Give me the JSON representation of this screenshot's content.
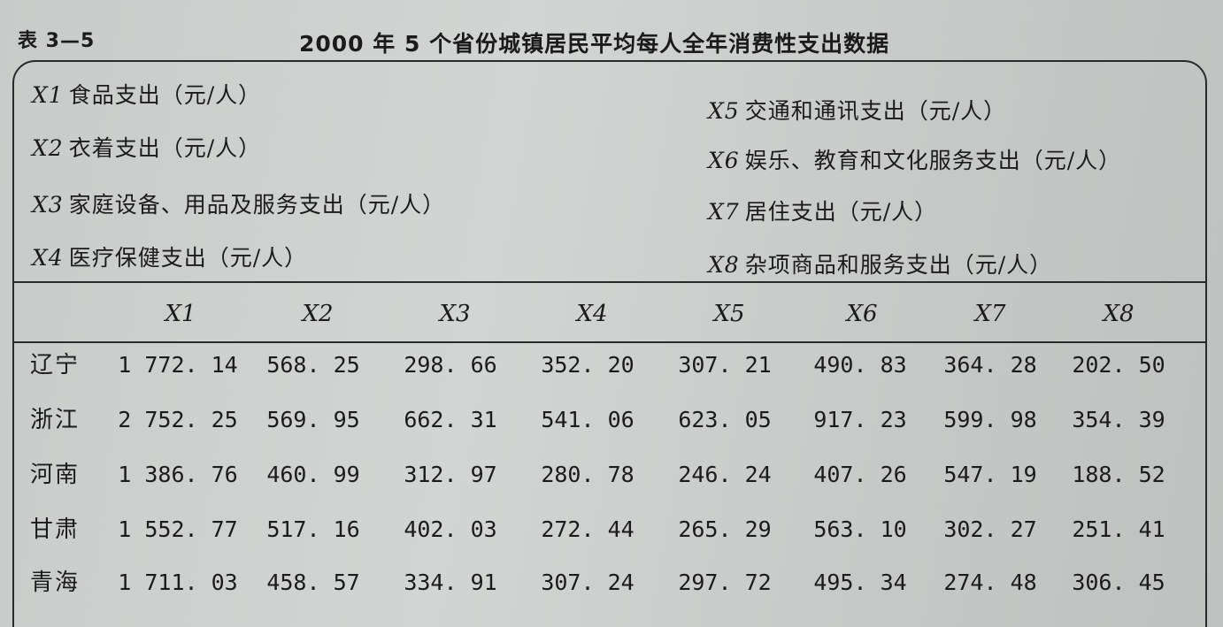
{
  "table_number": "表 3—5",
  "title": "2000 年 5 个省份城镇居民平均每人全年消费性支出数据",
  "legend": [
    {
      "code": "X1",
      "desc": "食品支出（元/人）"
    },
    {
      "code": "X2",
      "desc": "衣着支出（元/人）"
    },
    {
      "code": "X3",
      "desc": "家庭设备、用品及服务支出（元/人）"
    },
    {
      "code": "X4",
      "desc": "医疗保健支出（元/人）"
    },
    {
      "code": "X5",
      "desc": "交通和通讯支出（元/人）"
    },
    {
      "code": "X6",
      "desc": "娱乐、教育和文化服务支出（元/人）"
    },
    {
      "code": "X7",
      "desc": "居住支出（元/人）"
    },
    {
      "code": "X8",
      "desc": "杂项商品和服务支出（元/人）"
    }
  ],
  "columns": [
    "X1",
    "X2",
    "X3",
    "X4",
    "X5",
    "X6",
    "X7",
    "X8"
  ],
  "rows": [
    {
      "region": "辽宁",
      "values": [
        "1 772. 14",
        "568. 25",
        "298. 66",
        "352. 20",
        "307. 21",
        "490. 83",
        "364. 28",
        "202. 50"
      ]
    },
    {
      "region": "浙江",
      "values": [
        "2 752. 25",
        "569. 95",
        "662. 31",
        "541. 06",
        "623. 05",
        "917. 23",
        "599. 98",
        "354. 39"
      ]
    },
    {
      "region": "河南",
      "values": [
        "1 386. 76",
        "460. 99",
        "312. 97",
        "280. 78",
        "246. 24",
        "407. 26",
        "547. 19",
        "188. 52"
      ]
    },
    {
      "region": "甘肃",
      "values": [
        "1 552. 77",
        "517. 16",
        "402. 03",
        "272. 44",
        "265. 29",
        "563. 10",
        "302. 27",
        "251. 41"
      ]
    },
    {
      "region": "青海",
      "values": [
        "1 711. 03",
        "458. 57",
        "334. 91",
        "307. 24",
        "297. 72",
        "495. 34",
        "274. 48",
        "306. 45"
      ]
    }
  ]
}
